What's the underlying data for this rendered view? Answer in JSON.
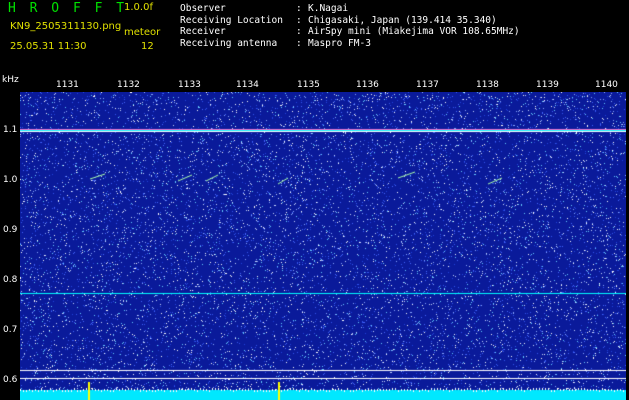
{
  "header": {
    "app_title": "H R O F F T",
    "version": "1.0.0f",
    "filename": "KN9_2505311130.png",
    "program": "meteor",
    "datetime": "25.05.31 11:30",
    "count": "12"
  },
  "station": [
    {
      "label": "Observer",
      "value": "K.Nagai"
    },
    {
      "label": "Receiving Location",
      "value": "Chigasaki, Japan (139.414 35.340)"
    },
    {
      "label": "Receiver",
      "value": "AirSpy mini (Miakejima VOR 108.65MHz)"
    },
    {
      "label": "Receiving antenna",
      "value": "Maspro FM-3"
    }
  ],
  "x_axis": {
    "ticks": [
      "1131",
      "1132",
      "1133",
      "1134",
      "1135",
      "1136",
      "1137",
      "1138",
      "1139",
      "1140"
    ]
  },
  "y_axis": {
    "unit": "kHz",
    "ticks": [
      "1.1",
      "1.0",
      "0.9",
      "0.8",
      "0.7",
      "0.6"
    ]
  },
  "colors": {
    "background": "#0a1a9a",
    "noise": "#ffffff",
    "signal": "#00ffff",
    "accent": "#e0e000",
    "title": "#00e000"
  }
}
